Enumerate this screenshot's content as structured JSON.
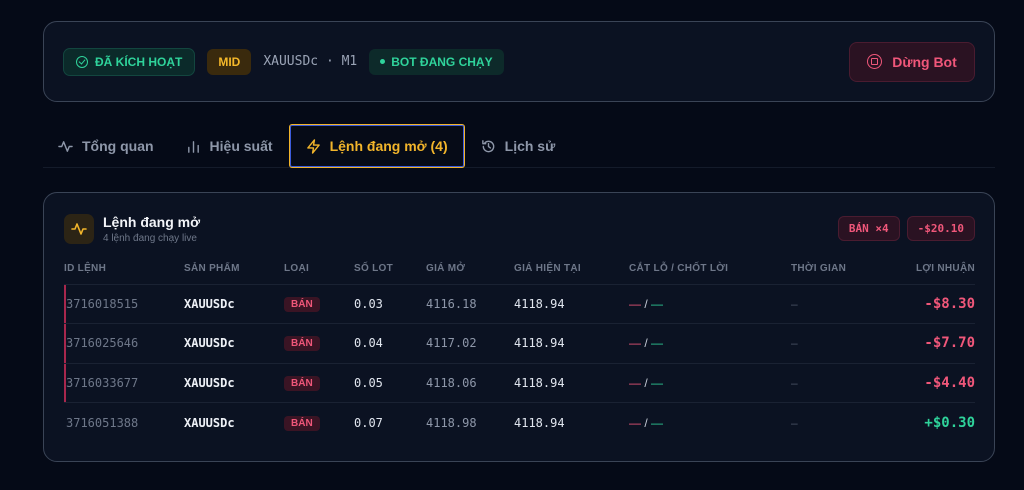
{
  "status": {
    "active_label": "ĐÃ KÍCH HOẠT",
    "level_label": "MID",
    "symbol_timeframe": "XAUUSDc · M1",
    "running_label": "BOT ĐANG CHẠY",
    "stop_button_label": "Dừng Bot"
  },
  "tabs": [
    {
      "label": "Tổng quan",
      "icon": "activity-icon"
    },
    {
      "label": "Hiệu suất",
      "icon": "bar-chart-icon"
    },
    {
      "label": "Lệnh đang mở (4)",
      "icon": "lightning-icon",
      "active": true
    },
    {
      "label": "Lịch sử",
      "icon": "history-icon"
    }
  ],
  "orders": {
    "title": "Lệnh đang mở",
    "subtitle": "4 lệnh đang chạy live",
    "sell_count_pill": "BÁN ×4",
    "total_pnl_pill": "-$20.10",
    "columns": [
      "ID LỆNH",
      "SẢN PHẨM",
      "LOẠI",
      "SỐ LOT",
      "GIÁ MỞ",
      "GIÁ HIỆN TẠI",
      "CẮT LỖ / CHỐT LỜI",
      "THỜI GIAN",
      "LỢI NHUẬN"
    ],
    "rows": [
      {
        "id": "3716018515",
        "symbol": "XAUUSDc",
        "type": "BÁN",
        "lot": "0.03",
        "open": "4116.18",
        "current": "4118.94",
        "sl": "—",
        "sep": "/",
        "tp": "—",
        "time": "–",
        "pnl": "-$8.30",
        "pnl_sign": "neg"
      },
      {
        "id": "3716025646",
        "symbol": "XAUUSDc",
        "type": "BÁN",
        "lot": "0.04",
        "open": "4117.02",
        "current": "4118.94",
        "sl": "—",
        "sep": "/",
        "tp": "—",
        "time": "–",
        "pnl": "-$7.70",
        "pnl_sign": "neg"
      },
      {
        "id": "3716033677",
        "symbol": "XAUUSDc",
        "type": "BÁN",
        "lot": "0.05",
        "open": "4118.06",
        "current": "4118.94",
        "sl": "—",
        "sep": "/",
        "tp": "—",
        "time": "–",
        "pnl": "-$4.40",
        "pnl_sign": "neg"
      },
      {
        "id": "3716051388",
        "symbol": "XAUUSDc",
        "type": "BÁN",
        "lot": "0.07",
        "open": "4118.98",
        "current": "4118.94",
        "sl": "—",
        "sep": "/",
        "tp": "—",
        "time": "–",
        "pnl": "+$0.30",
        "pnl_sign": "pos"
      }
    ]
  },
  "colors": {
    "background": "#050a17",
    "card": "#0b1222",
    "accent_gold": "#f2b52b",
    "positive": "#2fd39b",
    "negative": "#f0577a"
  }
}
